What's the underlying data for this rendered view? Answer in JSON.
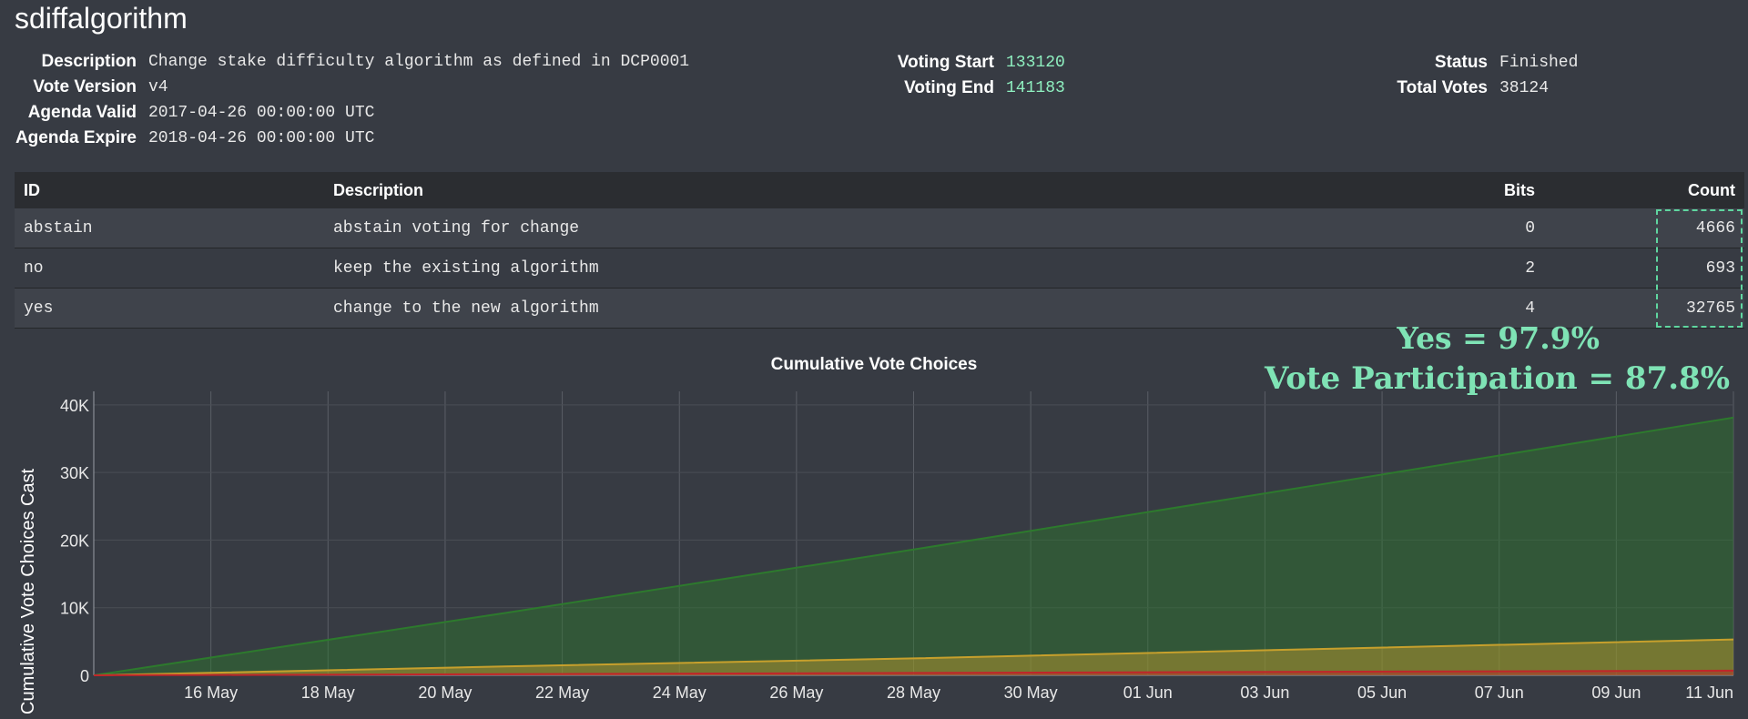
{
  "title": "sdiffalgorithm",
  "info_left": [
    {
      "label": "Description",
      "value": "Change stake difficulty algorithm as defined in DCP0001"
    },
    {
      "label": "Vote Version",
      "value": "v4"
    },
    {
      "label": "Agenda Valid",
      "value": "2017-04-26 00:00:00 UTC"
    },
    {
      "label": "Agenda Expire",
      "value": "2018-04-26 00:00:00 UTC"
    }
  ],
  "info_mid": [
    {
      "label": "Voting Start",
      "value": "133120"
    },
    {
      "label": "Voting End",
      "value": "141183"
    }
  ],
  "info_right": [
    {
      "label": "Status",
      "value": "Finished"
    },
    {
      "label": "Total Votes",
      "value": "38124"
    }
  ],
  "table": {
    "headers": [
      "ID",
      "Description",
      "Bits",
      "Count"
    ],
    "rows": [
      {
        "id": "abstain",
        "description": "abstain voting for change",
        "bits": "0",
        "count": "4666"
      },
      {
        "id": "no",
        "description": "keep the existing algorithm",
        "bits": "2",
        "count": "693"
      },
      {
        "id": "yes",
        "description": "change to the new algorithm",
        "bits": "4",
        "count": "32765"
      }
    ]
  },
  "overlay": {
    "yes_pct": "Yes = 97.9%",
    "participation": "Vote Participation = 87.8%"
  },
  "colors": {
    "accent": "#7fe3b5",
    "yes": "#2d7a2d",
    "abstain": "#c7a02c",
    "no": "#c0262a"
  },
  "chart_data": {
    "type": "area",
    "title": "Cumulative Vote Choices",
    "ylabel": "Cumulative Vote Choices Cast",
    "xlabel": "",
    "x_ticks": [
      "16 May",
      "18 May",
      "20 May",
      "22 May",
      "24 May",
      "26 May",
      "28 May",
      "30 May",
      "01 Jun",
      "03 Jun",
      "05 Jun",
      "07 Jun",
      "09 Jun",
      "11 Jun"
    ],
    "y_ticks": [
      "0",
      "10K",
      "20K",
      "30K",
      "40K"
    ],
    "ylim": [
      0,
      42000
    ],
    "xlim": [
      "2017-05-14",
      "2017-06-11"
    ],
    "grid": true,
    "stacked": false,
    "series": [
      {
        "color": "#2d7a2d",
        "x": [
          "2017-05-14",
          "2017-05-21",
          "2017-05-28",
          "2017-06-04",
          "2017-06-11"
        ],
        "values": [
          0,
          9200,
          18600,
          28300,
          38124
        ]
      },
      {
        "color": "#c7a02c",
        "x": [
          "2017-05-14",
          "2017-05-21",
          "2017-05-28",
          "2017-06-04",
          "2017-06-11"
        ],
        "values": [
          0,
          1300,
          2500,
          3900,
          5300
        ]
      },
      {
        "color": "#c0262a",
        "x": [
          "2017-05-14",
          "2017-05-21",
          "2017-05-28",
          "2017-06-04",
          "2017-06-11"
        ],
        "values": [
          0,
          180,
          350,
          520,
          693
        ]
      }
    ]
  }
}
